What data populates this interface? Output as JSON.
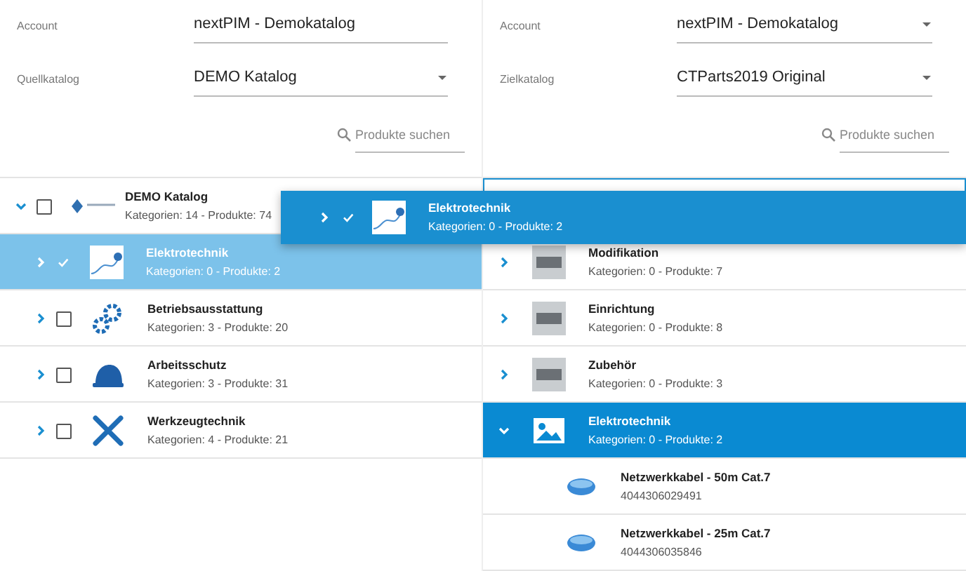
{
  "panels": [
    {
      "account": {
        "label": "Account",
        "value": "nextPIM - Demokatalog",
        "dropdown": false
      },
      "catalog": {
        "label": "Quellkatalog",
        "value": "DEMO Katalog",
        "dropdown": true
      },
      "search": {
        "placeholder": "Produkte suchen"
      },
      "tree": [
        {
          "title": "DEMO Katalog",
          "subtitle": "Kategorien: 14 - Produkte: 74",
          "expanded": true,
          "checked": false,
          "selected": false,
          "children": [
            {
              "title": "Elektrotechnik",
              "subtitle": "Kategorien: 0 - Produkte: 2",
              "expanded": false,
              "checked": true,
              "selected": true
            },
            {
              "title": "Betriebsausstattung",
              "subtitle": "Kategorien: 3 - Produkte: 20",
              "expanded": false,
              "checked": false,
              "selected": false
            },
            {
              "title": "Arbeitsschutz",
              "subtitle": "Kategorien: 3 - Produkte: 31",
              "expanded": false,
              "checked": false,
              "selected": false
            },
            {
              "title": "Werkzeugtechnik",
              "subtitle": "Kategorien: 4 - Produkte: 21",
              "expanded": false,
              "checked": false,
              "selected": false
            }
          ]
        }
      ]
    },
    {
      "account": {
        "label": "Account",
        "value": "nextPIM - Demokatalog",
        "dropdown": true
      },
      "catalog": {
        "label": "Zielkatalog",
        "value": "CTParts2019 Original",
        "dropdown": true
      },
      "search": {
        "placeholder": "Produkte suchen"
      },
      "tree": [
        {
          "children": [
            {
              "title": "Modifikation",
              "subtitle": "Kategorien: 0 - Produkte: 7",
              "expanded": false,
              "selected": false
            },
            {
              "title": "Einrichtung",
              "subtitle": "Kategorien: 0 - Produkte: 8",
              "expanded": false,
              "selected": false
            },
            {
              "title": "Zubehör",
              "subtitle": "Kategorien: 0 - Produkte: 3",
              "expanded": false,
              "selected": false
            },
            {
              "title": "Elektrotechnik",
              "subtitle": "Kategorien: 0 - Produkte: 2",
              "expanded": true,
              "selected": true,
              "children": [
                {
                  "title": "Netzwerkkabel - 50m Cat.7",
                  "subtitle": "4044306029491"
                },
                {
                  "title": "Netzwerkkabel - 25m Cat.7",
                  "subtitle": "4044306035846"
                }
              ]
            }
          ]
        }
      ]
    }
  ],
  "drag_preview": {
    "title": "Elektrotechnik",
    "subtitle": "Kategorien: 0 - Produkte: 2",
    "checked": true
  }
}
